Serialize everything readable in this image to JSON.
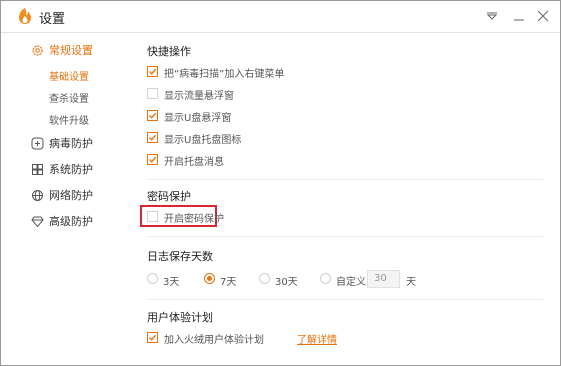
{
  "window": {
    "title": "设置"
  },
  "sidebar": {
    "items": [
      {
        "label": "常规设置",
        "icon": "gear-icon"
      },
      {
        "label": "病毒防护",
        "icon": "plus-square-icon"
      },
      {
        "label": "系统防护",
        "icon": "windows-icon"
      },
      {
        "label": "网络防护",
        "icon": "globe-icon"
      },
      {
        "label": "高级防护",
        "icon": "diamond-icon"
      }
    ],
    "subitems": [
      "基础设置",
      "查杀设置",
      "软件升级"
    ]
  },
  "shortcuts": {
    "title": "快捷操作",
    "options": [
      {
        "label": "把“病毒扫描”加入右键菜单",
        "checked": true
      },
      {
        "label": "显示流量悬浮窗",
        "checked": false
      },
      {
        "label": "显示U盘悬浮窗",
        "checked": true
      },
      {
        "label": "显示U盘托盘图标",
        "checked": true
      },
      {
        "label": "开启托盘消息",
        "checked": true
      }
    ]
  },
  "password": {
    "title": "密码保护",
    "option": {
      "label": "开启密码保护",
      "checked": false
    }
  },
  "log": {
    "title": "日志保存天数",
    "options": [
      "3天",
      "7天",
      "30天",
      "自定义"
    ],
    "selected": "7天",
    "custom_value": "30",
    "unit": "天"
  },
  "ux": {
    "title": "用户体验计划",
    "option": {
      "label": "加入火绒用户体验计划",
      "checked": true
    },
    "link": "了解详情"
  },
  "colors": {
    "accent": "#e8720c",
    "highlight": "#d9272f"
  }
}
